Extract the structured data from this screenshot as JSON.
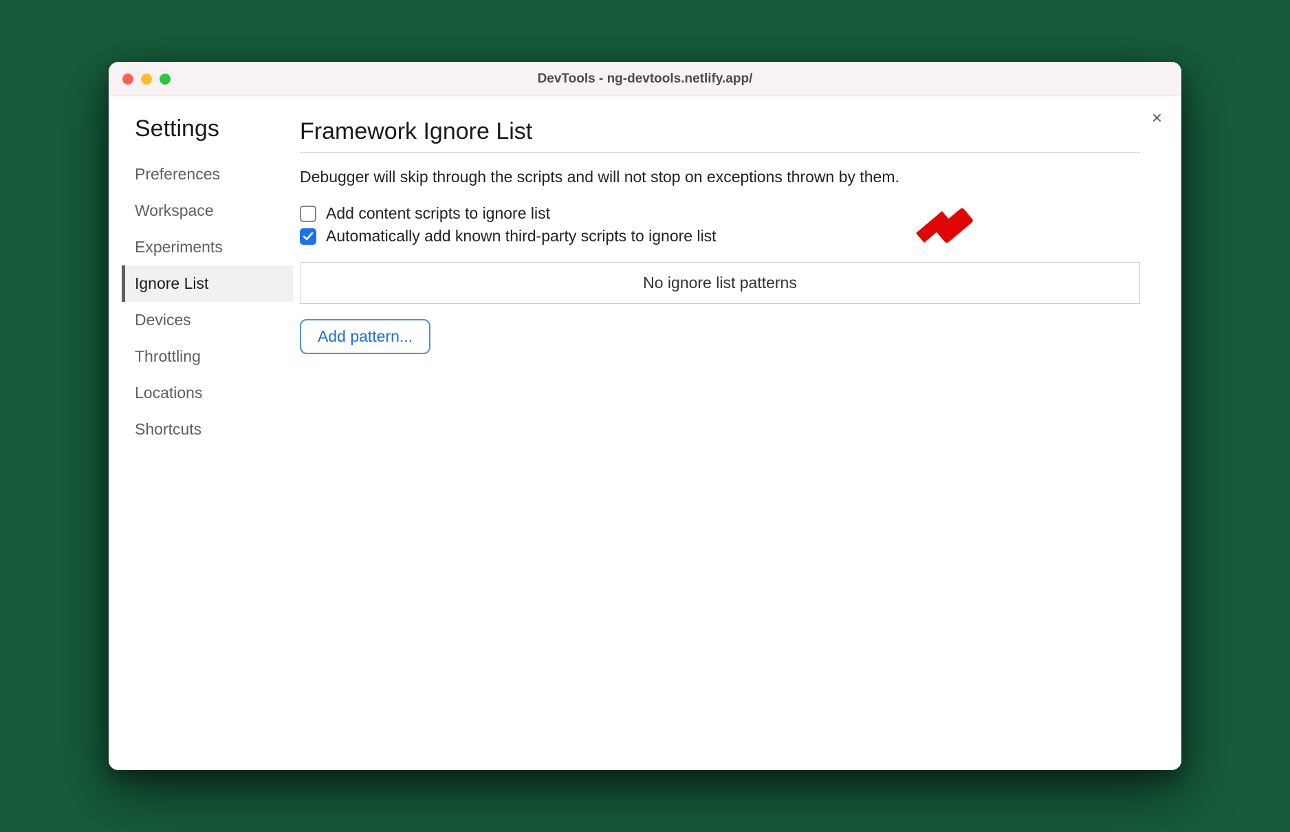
{
  "window": {
    "title": "DevTools - ng-devtools.netlify.app/"
  },
  "close_icon_label": "×",
  "sidebar": {
    "title": "Settings",
    "items": [
      {
        "label": "Preferences",
        "selected": false
      },
      {
        "label": "Workspace",
        "selected": false
      },
      {
        "label": "Experiments",
        "selected": false
      },
      {
        "label": "Ignore List",
        "selected": true
      },
      {
        "label": "Devices",
        "selected": false
      },
      {
        "label": "Throttling",
        "selected": false
      },
      {
        "label": "Locations",
        "selected": false
      },
      {
        "label": "Shortcuts",
        "selected": false
      }
    ]
  },
  "panel": {
    "title": "Framework Ignore List",
    "description": "Debugger will skip through the scripts and will not stop on exceptions thrown by them.",
    "checkboxes": [
      {
        "label": "Add content scripts to ignore list",
        "checked": false
      },
      {
        "label": "Automatically add known third-party scripts to ignore list",
        "checked": true
      }
    ],
    "empty_patterns_text": "No ignore list patterns",
    "add_pattern_label": "Add pattern..."
  },
  "annotation": {
    "color": "#e10505",
    "points_to": "auto-add-third-party-checkbox"
  }
}
